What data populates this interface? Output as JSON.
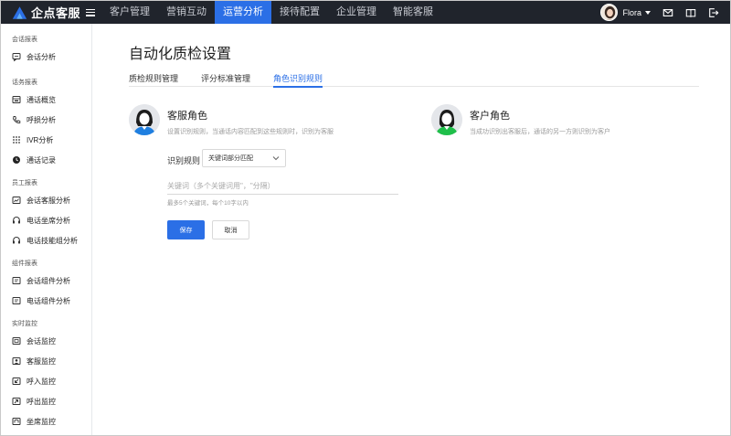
{
  "header": {
    "brand": "企点客服",
    "nav": [
      {
        "label": "客户管理",
        "active": false
      },
      {
        "label": "营销互动",
        "active": false
      },
      {
        "label": "运营分析",
        "active": true
      },
      {
        "label": "接待配置",
        "active": false
      },
      {
        "label": "企业管理",
        "active": false
      },
      {
        "label": "智能客服",
        "active": false
      }
    ],
    "user": "Flora"
  },
  "sidebar": {
    "groups": [
      {
        "title": "会话报表",
        "items": [
          {
            "label": "会话分析",
            "icon": "chat-bubble-icon"
          }
        ]
      },
      {
        "title": "话务报表",
        "items": [
          {
            "label": "通话概览",
            "icon": "overview-icon"
          },
          {
            "label": "呼损分析",
            "icon": "phone-icon"
          },
          {
            "label": "IVR分析",
            "icon": "ivr-icon"
          },
          {
            "label": "通话记录",
            "icon": "clock-icon"
          }
        ]
      },
      {
        "title": "员工报表",
        "items": [
          {
            "label": "会话客服分析",
            "icon": "agent-chart-icon"
          },
          {
            "label": "电话坐席分析",
            "icon": "headset-icon"
          },
          {
            "label": "电话技能组分析",
            "icon": "headset-icon"
          }
        ]
      },
      {
        "title": "组件报表",
        "items": [
          {
            "label": "会话组件分析",
            "icon": "component-icon"
          },
          {
            "label": "电话组件分析",
            "icon": "component-icon"
          }
        ]
      },
      {
        "title": "实时监控",
        "items": [
          {
            "label": "会话监控",
            "icon": "monitor-icon"
          },
          {
            "label": "客服监控",
            "icon": "agent-monitor-icon"
          },
          {
            "label": "呼入监控",
            "icon": "call-in-icon"
          },
          {
            "label": "呼出监控",
            "icon": "call-out-icon"
          },
          {
            "label": "坐席监控",
            "icon": "seat-monitor-icon"
          }
        ]
      }
    ]
  },
  "main": {
    "title": "自动化质检设置",
    "tabs": [
      {
        "label": "质检规则管理",
        "active": false
      },
      {
        "label": "评分标准管理",
        "active": false
      },
      {
        "label": "角色识别规则",
        "active": true
      }
    ],
    "agent_role": {
      "title": "客服角色",
      "desc": "设置识别规则，当通话内容匹配到这些规则时，识别为客服"
    },
    "customer_role": {
      "title": "客户角色",
      "desc": "当成功识别出客服后，通话的另一方则识别为客户"
    },
    "rule_label": "识别规则",
    "rule_select": "关键词部分匹配",
    "keyword_placeholder": "关键词（多个关键词用\"，\"分隔）",
    "keyword_hint": "最多5个关键词，每个10字以内",
    "save_label": "保存",
    "cancel_label": "取消"
  },
  "colors": {
    "accent": "#2b6fe6",
    "topbar": "#20242c",
    "agent_shirt": "#1f7fe0",
    "customer_shirt": "#1fbf4a"
  }
}
